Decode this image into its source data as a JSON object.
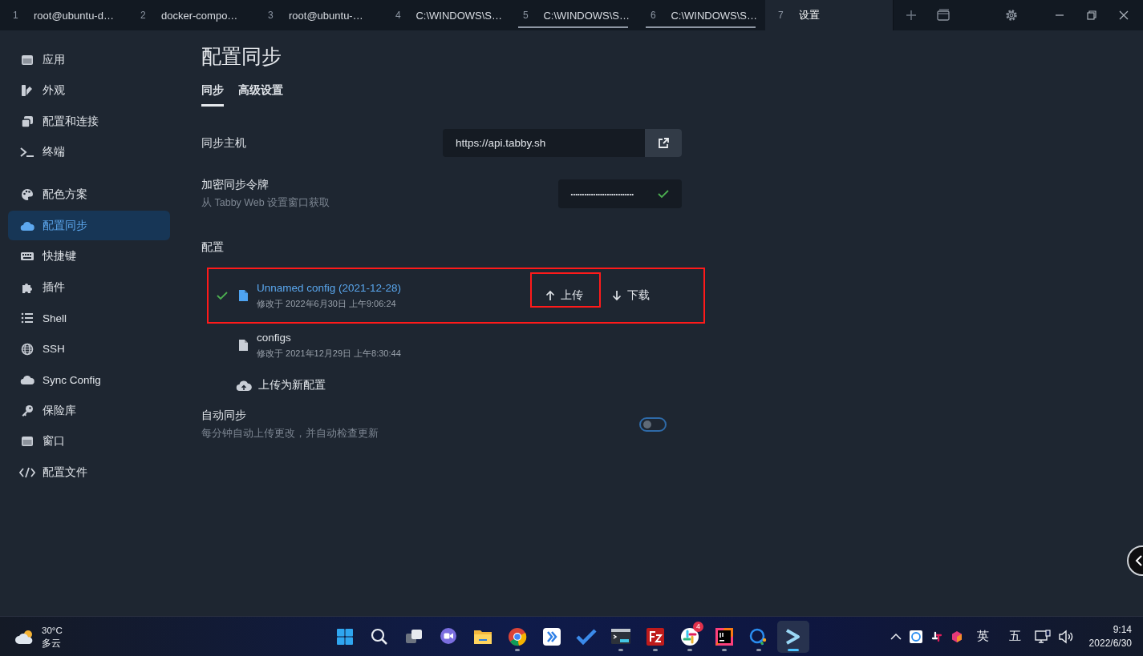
{
  "tabs": [
    {
      "number": "1",
      "title": "root@ubuntu-d…",
      "selected": false,
      "activity": false
    },
    {
      "number": "2",
      "title": "docker-compo…",
      "selected": false,
      "activity": false
    },
    {
      "number": "3",
      "title": "root@ubuntu-…",
      "selected": false,
      "activity": false
    },
    {
      "number": "4",
      "title": "C:\\WINDOWS\\S…",
      "selected": false,
      "activity": false
    },
    {
      "number": "5",
      "title": "C:\\WINDOWS\\S…",
      "selected": false,
      "activity": true
    },
    {
      "number": "6",
      "title": "C:\\WINDOWS\\S…",
      "selected": false,
      "activity": true
    },
    {
      "number": "7",
      "title": "设置",
      "selected": true,
      "activity": false
    }
  ],
  "sidebar": {
    "groups": [
      [
        {
          "label": "应用",
          "kind": "window",
          "selected": false
        },
        {
          "label": "外观",
          "kind": "brush",
          "selected": false
        },
        {
          "label": "配置和连接",
          "kind": "copy",
          "selected": false
        },
        {
          "label": "终端",
          "kind": "prompt",
          "selected": false
        }
      ],
      [
        {
          "label": "配色方案",
          "kind": "palette",
          "selected": false
        },
        {
          "label": "配置同步",
          "kind": "cloud",
          "selected": true
        },
        {
          "label": "快捷键",
          "kind": "keyboard",
          "selected": false
        },
        {
          "label": "插件",
          "kind": "puzzle",
          "selected": false
        },
        {
          "label": "Shell",
          "kind": "list",
          "selected": false
        },
        {
          "label": "SSH",
          "kind": "globe",
          "selected": false
        },
        {
          "label": "Sync Config",
          "kind": "cloud",
          "selected": false
        },
        {
          "label": "保险库",
          "kind": "key",
          "selected": false
        },
        {
          "label": "窗口",
          "kind": "window",
          "selected": false
        },
        {
          "label": "配置文件",
          "kind": "code",
          "selected": false
        }
      ]
    ]
  },
  "page": {
    "title": "配置同步",
    "subtabs": [
      {
        "label": "同步",
        "selected": true
      },
      {
        "label": "高级设置",
        "selected": false
      }
    ],
    "sync_host": {
      "label": "同步主机",
      "value": "https://api.tabby.sh"
    },
    "token": {
      "label": "加密同步令牌",
      "hint": "从 Tabby Web 设置窗口获取",
      "value": "••••••••••••••••••••••••••••",
      "valid": true
    },
    "configs_label": "配置",
    "configs": [
      {
        "name": "Unnamed config (2021-12-28)",
        "modified": "修改于 2022年6月30日 上午9:06:24",
        "current": true,
        "highlighted": true,
        "actions": [
          {
            "kind": "upload",
            "label": "上传",
            "highlighted": true
          },
          {
            "kind": "download",
            "label": "下载",
            "highlighted": false
          }
        ]
      },
      {
        "name": "configs",
        "modified": "修改于 2021年12月29日 上午8:30:44",
        "current": false,
        "highlighted": false
      }
    ],
    "upload_new": "上传为新配置",
    "auto_sync": {
      "label": "自动同步",
      "hint": "每分钟自动上传更改，并自动检查更新",
      "on": false
    }
  },
  "taskbar": {
    "weather": {
      "temp": "30°C",
      "desc": "多云"
    },
    "apps": [
      {
        "kind": "start",
        "running": false,
        "active": false
      },
      {
        "kind": "search",
        "running": false,
        "active": false
      },
      {
        "kind": "taskview",
        "running": false,
        "active": false
      },
      {
        "kind": "meet",
        "running": false,
        "active": false
      },
      {
        "kind": "folder",
        "running": false,
        "active": false
      },
      {
        "kind": "chrome",
        "running": true,
        "active": false
      },
      {
        "kind": "bluebox",
        "running": false,
        "active": false
      },
      {
        "kind": "todo",
        "running": false,
        "active": false
      },
      {
        "kind": "terminal",
        "running": true,
        "active": false
      },
      {
        "kind": "ftp",
        "running": true,
        "active": false
      },
      {
        "kind": "slack",
        "running": true,
        "active": false,
        "badge": "4"
      },
      {
        "kind": "ide",
        "running": true,
        "active": false
      },
      {
        "kind": "chat",
        "running": true,
        "active": false
      },
      {
        "kind": "tabby",
        "running": true,
        "active": true
      }
    ],
    "ime": [
      "英",
      "五"
    ],
    "time": "9:14",
    "date": "2022/6/30"
  }
}
